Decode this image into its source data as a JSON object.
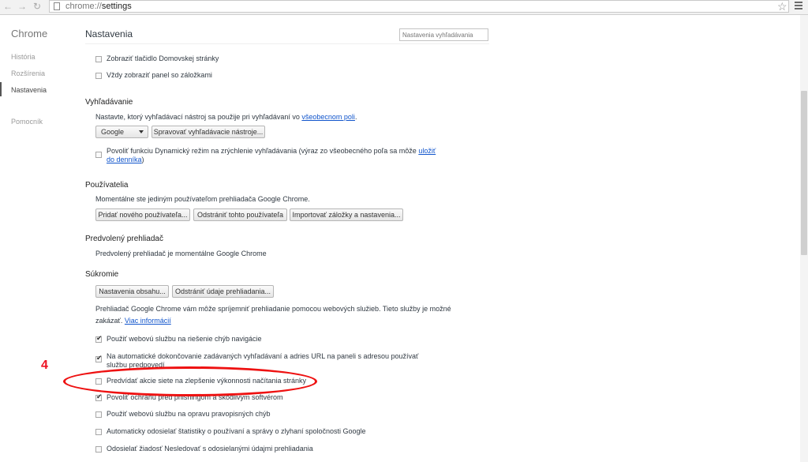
{
  "browser": {
    "url_scheme": "chrome://",
    "url_host": "settings"
  },
  "sidebar": {
    "brand": "Chrome",
    "items": [
      {
        "label": "História"
      },
      {
        "label": "Rozšírenia"
      },
      {
        "label": "Nastavenia"
      },
      {
        "label": "Pomocník"
      }
    ]
  },
  "header": {
    "title": "Nastavenia",
    "search_placeholder": "Nastavenia vyhľadávania"
  },
  "appearance": {
    "show_home": {
      "label": "Zobraziť tlačidlo Domovskej stránky",
      "checked": false
    },
    "bookmarks_bar": {
      "label": "Vždy zobraziť panel so záložkami",
      "checked": false
    }
  },
  "search": {
    "title": "Vyhľadávanie",
    "desc_prefix": "Nastavte, ktorý vyhľadávací nástroj sa použije pri vyhľadávaní vo ",
    "desc_link": "všeobecnom poli",
    "desc_suffix": ".",
    "engine": "Google",
    "manage_label": "Spravovať vyhľadávacie nástroje...",
    "instant_prefix": "Povoliť funkciu Dynamický režim na zrýchlenie vyhľadávania (výraz zo všeobecného poľa sa môže ",
    "instant_link": "uložiť do denníka",
    "instant_suffix": ")"
  },
  "users": {
    "title": "Používatelia",
    "desc": "Momentálne ste jediným používateľom prehliadača Google Chrome.",
    "add_label": "Pridať nového používateľa...",
    "remove_label": "Odstrániť tohto používateľa",
    "import_label": "Importovať záložky a nastavenia..."
  },
  "default_browser": {
    "title": "Predvolený prehliadač",
    "desc": "Predvolený prehliadač je momentálne Google Chrome"
  },
  "privacy": {
    "title": "Súkromie",
    "content_label": "Nastavenia obsahu...",
    "clear_label": "Odstrániť údaje prehliadania...",
    "desc_line1": "Prehliadač Google Chrome vám môže spríjemniť prehliadanie pomocou webových služieb. Tieto služby je možné",
    "desc_line2": "zakázať. ",
    "desc_link": "Viac informácií",
    "options": [
      {
        "label": "Použiť webovú službu na riešenie chýb navigácie",
        "checked": true
      },
      {
        "label": "Na automatické dokončovanie zadávaných vyhľadávaní a adries URL na paneli s adresou používať službu predpovedí",
        "checked": true
      },
      {
        "label": "Predvídať akcie siete na zlepšenie výkonnosti načítania stránky",
        "checked": false
      },
      {
        "label": "Povoliť ochranu pred phishingom a škodlivým softvérom",
        "checked": true
      },
      {
        "label": "Použiť webovú službu na opravu pravopisných chýb",
        "checked": false
      },
      {
        "label": "Automaticky odosielať štatistiky o používaní a správy o zlyhaní spoločnosti Google",
        "checked": false
      },
      {
        "label": "Odosielať žiadosť Nesledovať s odosielanými údajmi prehliadania",
        "checked": false
      }
    ]
  },
  "annotation": {
    "number": "4",
    "color": "#e11111"
  }
}
